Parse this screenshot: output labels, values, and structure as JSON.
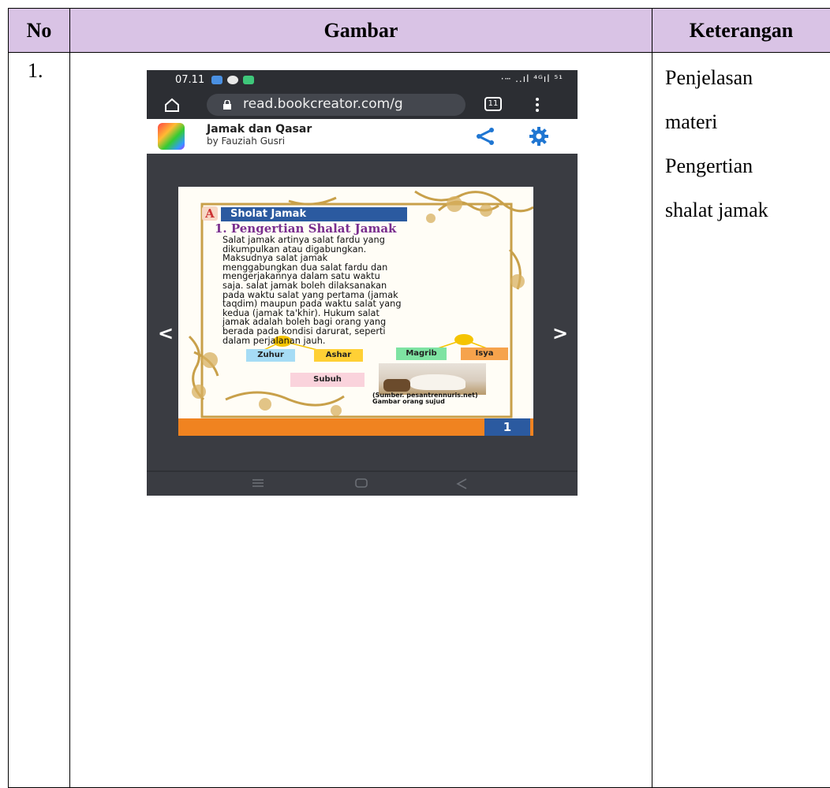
{
  "table": {
    "headers": {
      "no": "No",
      "gambar": "Gambar",
      "keterangan": "Keterangan"
    },
    "rows": [
      {
        "no": "1.",
        "keterangan_lines": [
          "Penjelasan",
          "materi",
          "Pengertian",
          "shalat jamak"
        ]
      }
    ]
  },
  "phone": {
    "status": {
      "time": "07.11",
      "right": "·ⵈ ..ıl ⁴ᴳıl ⁵¹"
    },
    "browser": {
      "url": "read.bookcreator.com/g",
      "tab_count": "11"
    },
    "app": {
      "title": "Jamak dan Qasar",
      "author": "by Fauziah Gusri"
    },
    "book": {
      "badge_letter": "A",
      "section_header": "Sholat Jamak",
      "subtitle": "1. Pengertian Shalat Jamak",
      "paragraph_lines": [
        "Salat jamak artinya salat fardu yang",
        "dikumpulkan atau digabungkan.",
        "Maksudnya salat jamak",
        "menggabungkan dua salat fardu dan",
        "mengerjakannya dalam satu waktu",
        "saja. salat jamak boleh dilaksanakan",
        "pada waktu salat yang pertama (jamak",
        "taqdim) maupun pada waktu salat yang",
        "kedua (jamak ta'khir). Hukum salat",
        "jamak adalah boleh bagi orang yang",
        "berada pada kondisi darurat, seperti",
        "dalam perjalanan jauh."
      ],
      "prayers": [
        "Zuhur",
        "Ashar",
        "Magrib",
        "Isya",
        "Subuh"
      ],
      "caption_lines": [
        "(Sumber. pesantrennuris.net)",
        "Gambar orang sujud"
      ],
      "page_number": "1"
    }
  },
  "colors": {
    "header_bg": "#d9c3e5",
    "book_blue": "#2b5aa0",
    "book_orange": "#f08320",
    "title_purple": "#7a2e8e"
  }
}
